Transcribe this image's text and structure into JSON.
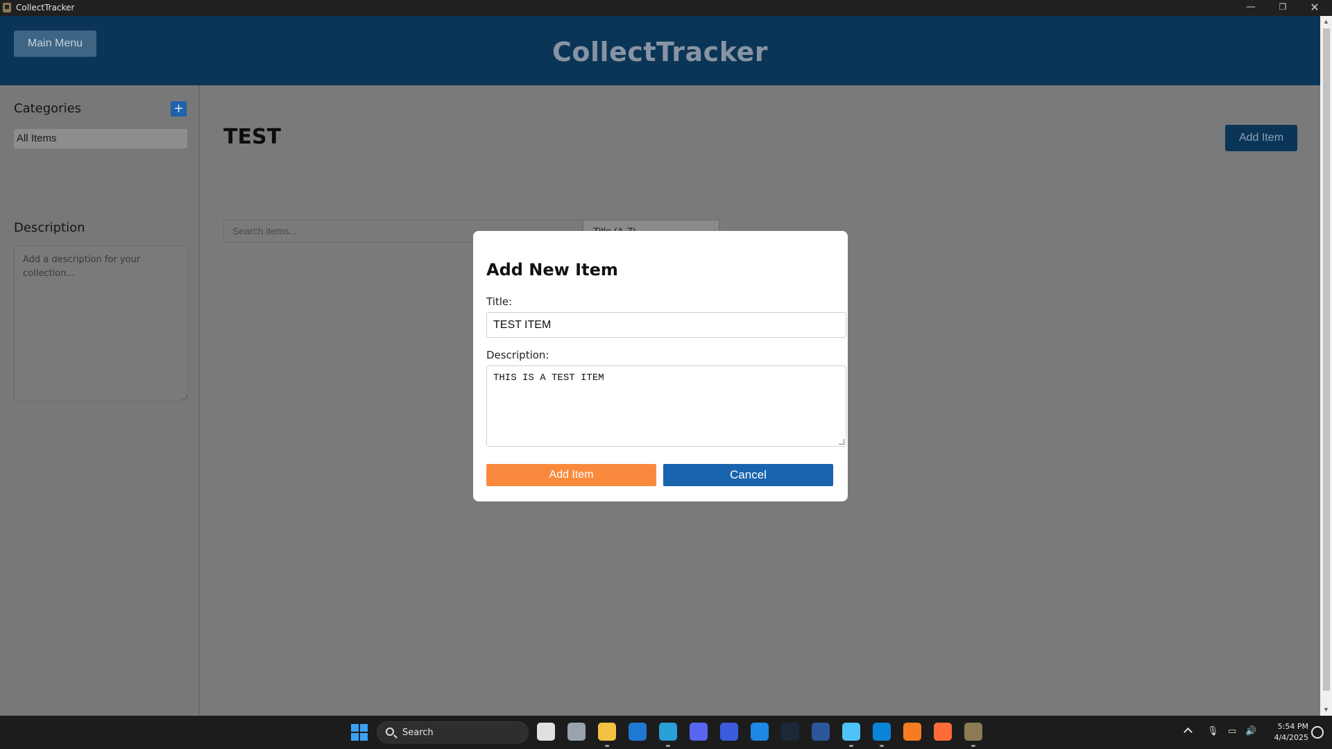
{
  "window": {
    "title": "CollectTracker",
    "controls": {
      "minimize": "—",
      "maximize": "❐",
      "close": "✕"
    }
  },
  "header": {
    "main_menu_label": "Main Menu",
    "app_title": "CollectTracker"
  },
  "sidebar": {
    "categories_heading": "Categories",
    "add_category_label": "+",
    "items": [
      {
        "label": "All Items"
      }
    ],
    "description_heading": "Description",
    "description_placeholder": "Add a description for your collection..."
  },
  "content": {
    "collection_title": "TEST",
    "add_item_label": "Add Item",
    "search_placeholder": "Search items...",
    "sort_selected": "Title (A-Z)"
  },
  "modal": {
    "heading": "Add New Item",
    "title_label": "Title:",
    "title_value": "TEST ITEM",
    "description_label": "Description:",
    "description_value": "THIS IS A TEST ITEM",
    "add_button": "Add Item",
    "cancel_button": "Cancel"
  },
  "taskbar": {
    "search_label": "Search",
    "clock_time": "5:54 PM",
    "clock_date": "4/4/2025",
    "apps": [
      {
        "name": "task-view",
        "color": "#e0e0e0"
      },
      {
        "name": "settings",
        "color": "#9aa3ad"
      },
      {
        "name": "file-explorer",
        "color": "#f3c244"
      },
      {
        "name": "outlook",
        "color": "#1f78d1"
      },
      {
        "name": "edge",
        "color": "#2a9fd8"
      },
      {
        "name": "discord",
        "color": "#5865f2"
      },
      {
        "name": "teams-like",
        "color": "#3b5bdb"
      },
      {
        "name": "bing",
        "color": "#1e88e5"
      },
      {
        "name": "steam",
        "color": "#1b2838"
      },
      {
        "name": "word",
        "color": "#2b579a"
      },
      {
        "name": "notepad",
        "color": "#4fc3f7"
      },
      {
        "name": "vs-code",
        "color": "#0a84d6"
      },
      {
        "name": "xampp",
        "color": "#f57c20"
      },
      {
        "name": "postman",
        "color": "#ff6c37"
      },
      {
        "name": "collecttracker",
        "color": "#8c7a55"
      }
    ]
  }
}
